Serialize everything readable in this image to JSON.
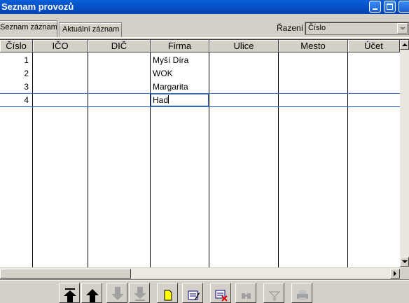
{
  "window": {
    "title": "Seznam provozů"
  },
  "tabs": [
    {
      "label": "Seznam záznamů",
      "active": true
    },
    {
      "label": "Aktuální záznam",
      "active": false
    }
  ],
  "sort": {
    "label": "Řazení",
    "value": "Číslo"
  },
  "table": {
    "columns": [
      "Číslo",
      "IČO",
      "DIČ",
      "Firma",
      "Ulice",
      "Mesto",
      "Účet"
    ],
    "rows": [
      {
        "cislo": "1",
        "firma": "Myší Díra"
      },
      {
        "cislo": "2",
        "firma": "WOK"
      },
      {
        "cislo": "3",
        "firma": "Margarita"
      },
      {
        "cislo": "4",
        "firma": "Had"
      }
    ],
    "selected_row": 4
  },
  "toolbar": {
    "buttons": [
      {
        "name": "first-record-icon",
        "enabled": true
      },
      {
        "name": "previous-record-icon",
        "enabled": true
      },
      {
        "name": "next-record-icon",
        "enabled": false
      },
      {
        "name": "last-record-icon",
        "enabled": false
      },
      {
        "name": "new-record-icon",
        "enabled": true
      },
      {
        "name": "edit-record-icon",
        "enabled": true
      },
      {
        "name": "delete-record-icon",
        "enabled": true
      },
      {
        "name": "find-icon",
        "enabled": false
      },
      {
        "name": "filter-icon",
        "enabled": false
      },
      {
        "name": "print-icon",
        "enabled": false
      }
    ]
  },
  "colors": {
    "titlebar": "#0653c9",
    "selection": "#316ac5",
    "face": "#d4d0c8"
  }
}
